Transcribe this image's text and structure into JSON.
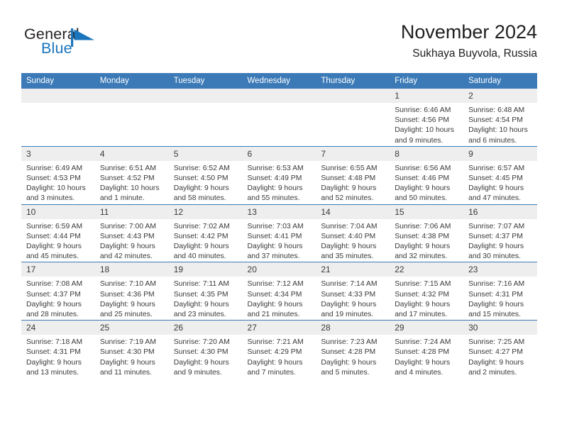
{
  "brand": {
    "name_part1": "General",
    "name_part2": "Blue",
    "logo_color": "#1b75bc"
  },
  "header": {
    "title": "November 2024",
    "location": "Sukhaya Buyvola, Russia",
    "accent_color": "#3b7ab7"
  },
  "weekday_headers": [
    "Sunday",
    "Monday",
    "Tuesday",
    "Wednesday",
    "Thursday",
    "Friday",
    "Saturday"
  ],
  "labels": {
    "sunrise_prefix": "Sunrise:",
    "sunset_prefix": "Sunset:",
    "daylight_prefix": "Daylight:"
  },
  "weeks": [
    [
      {
        "day": "",
        "sunrise": "",
        "sunset": "",
        "daylight_line1": "",
        "daylight_line2": ""
      },
      {
        "day": "",
        "sunrise": "",
        "sunset": "",
        "daylight_line1": "",
        "daylight_line2": ""
      },
      {
        "day": "",
        "sunrise": "",
        "sunset": "",
        "daylight_line1": "",
        "daylight_line2": ""
      },
      {
        "day": "",
        "sunrise": "",
        "sunset": "",
        "daylight_line1": "",
        "daylight_line2": ""
      },
      {
        "day": "",
        "sunrise": "",
        "sunset": "",
        "daylight_line1": "",
        "daylight_line2": ""
      },
      {
        "day": "1",
        "sunrise": "Sunrise: 6:46 AM",
        "sunset": "Sunset: 4:56 PM",
        "daylight_line1": "Daylight: 10 hours",
        "daylight_line2": "and 9 minutes."
      },
      {
        "day": "2",
        "sunrise": "Sunrise: 6:48 AM",
        "sunset": "Sunset: 4:54 PM",
        "daylight_line1": "Daylight: 10 hours",
        "daylight_line2": "and 6 minutes."
      }
    ],
    [
      {
        "day": "3",
        "sunrise": "Sunrise: 6:49 AM",
        "sunset": "Sunset: 4:53 PM",
        "daylight_line1": "Daylight: 10 hours",
        "daylight_line2": "and 3 minutes."
      },
      {
        "day": "4",
        "sunrise": "Sunrise: 6:51 AM",
        "sunset": "Sunset: 4:52 PM",
        "daylight_line1": "Daylight: 10 hours",
        "daylight_line2": "and 1 minute."
      },
      {
        "day": "5",
        "sunrise": "Sunrise: 6:52 AM",
        "sunset": "Sunset: 4:50 PM",
        "daylight_line1": "Daylight: 9 hours",
        "daylight_line2": "and 58 minutes."
      },
      {
        "day": "6",
        "sunrise": "Sunrise: 6:53 AM",
        "sunset": "Sunset: 4:49 PM",
        "daylight_line1": "Daylight: 9 hours",
        "daylight_line2": "and 55 minutes."
      },
      {
        "day": "7",
        "sunrise": "Sunrise: 6:55 AM",
        "sunset": "Sunset: 4:48 PM",
        "daylight_line1": "Daylight: 9 hours",
        "daylight_line2": "and 52 minutes."
      },
      {
        "day": "8",
        "sunrise": "Sunrise: 6:56 AM",
        "sunset": "Sunset: 4:46 PM",
        "daylight_line1": "Daylight: 9 hours",
        "daylight_line2": "and 50 minutes."
      },
      {
        "day": "9",
        "sunrise": "Sunrise: 6:57 AM",
        "sunset": "Sunset: 4:45 PM",
        "daylight_line1": "Daylight: 9 hours",
        "daylight_line2": "and 47 minutes."
      }
    ],
    [
      {
        "day": "10",
        "sunrise": "Sunrise: 6:59 AM",
        "sunset": "Sunset: 4:44 PM",
        "daylight_line1": "Daylight: 9 hours",
        "daylight_line2": "and 45 minutes."
      },
      {
        "day": "11",
        "sunrise": "Sunrise: 7:00 AM",
        "sunset": "Sunset: 4:43 PM",
        "daylight_line1": "Daylight: 9 hours",
        "daylight_line2": "and 42 minutes."
      },
      {
        "day": "12",
        "sunrise": "Sunrise: 7:02 AM",
        "sunset": "Sunset: 4:42 PM",
        "daylight_line1": "Daylight: 9 hours",
        "daylight_line2": "and 40 minutes."
      },
      {
        "day": "13",
        "sunrise": "Sunrise: 7:03 AM",
        "sunset": "Sunset: 4:41 PM",
        "daylight_line1": "Daylight: 9 hours",
        "daylight_line2": "and 37 minutes."
      },
      {
        "day": "14",
        "sunrise": "Sunrise: 7:04 AM",
        "sunset": "Sunset: 4:40 PM",
        "daylight_line1": "Daylight: 9 hours",
        "daylight_line2": "and 35 minutes."
      },
      {
        "day": "15",
        "sunrise": "Sunrise: 7:06 AM",
        "sunset": "Sunset: 4:38 PM",
        "daylight_line1": "Daylight: 9 hours",
        "daylight_line2": "and 32 minutes."
      },
      {
        "day": "16",
        "sunrise": "Sunrise: 7:07 AM",
        "sunset": "Sunset: 4:37 PM",
        "daylight_line1": "Daylight: 9 hours",
        "daylight_line2": "and 30 minutes."
      }
    ],
    [
      {
        "day": "17",
        "sunrise": "Sunrise: 7:08 AM",
        "sunset": "Sunset: 4:37 PM",
        "daylight_line1": "Daylight: 9 hours",
        "daylight_line2": "and 28 minutes."
      },
      {
        "day": "18",
        "sunrise": "Sunrise: 7:10 AM",
        "sunset": "Sunset: 4:36 PM",
        "daylight_line1": "Daylight: 9 hours",
        "daylight_line2": "and 25 minutes."
      },
      {
        "day": "19",
        "sunrise": "Sunrise: 7:11 AM",
        "sunset": "Sunset: 4:35 PM",
        "daylight_line1": "Daylight: 9 hours",
        "daylight_line2": "and 23 minutes."
      },
      {
        "day": "20",
        "sunrise": "Sunrise: 7:12 AM",
        "sunset": "Sunset: 4:34 PM",
        "daylight_line1": "Daylight: 9 hours",
        "daylight_line2": "and 21 minutes."
      },
      {
        "day": "21",
        "sunrise": "Sunrise: 7:14 AM",
        "sunset": "Sunset: 4:33 PM",
        "daylight_line1": "Daylight: 9 hours",
        "daylight_line2": "and 19 minutes."
      },
      {
        "day": "22",
        "sunrise": "Sunrise: 7:15 AM",
        "sunset": "Sunset: 4:32 PM",
        "daylight_line1": "Daylight: 9 hours",
        "daylight_line2": "and 17 minutes."
      },
      {
        "day": "23",
        "sunrise": "Sunrise: 7:16 AM",
        "sunset": "Sunset: 4:31 PM",
        "daylight_line1": "Daylight: 9 hours",
        "daylight_line2": "and 15 minutes."
      }
    ],
    [
      {
        "day": "24",
        "sunrise": "Sunrise: 7:18 AM",
        "sunset": "Sunset: 4:31 PM",
        "daylight_line1": "Daylight: 9 hours",
        "daylight_line2": "and 13 minutes."
      },
      {
        "day": "25",
        "sunrise": "Sunrise: 7:19 AM",
        "sunset": "Sunset: 4:30 PM",
        "daylight_line1": "Daylight: 9 hours",
        "daylight_line2": "and 11 minutes."
      },
      {
        "day": "26",
        "sunrise": "Sunrise: 7:20 AM",
        "sunset": "Sunset: 4:30 PM",
        "daylight_line1": "Daylight: 9 hours",
        "daylight_line2": "and 9 minutes."
      },
      {
        "day": "27",
        "sunrise": "Sunrise: 7:21 AM",
        "sunset": "Sunset: 4:29 PM",
        "daylight_line1": "Daylight: 9 hours",
        "daylight_line2": "and 7 minutes."
      },
      {
        "day": "28",
        "sunrise": "Sunrise: 7:23 AM",
        "sunset": "Sunset: 4:28 PM",
        "daylight_line1": "Daylight: 9 hours",
        "daylight_line2": "and 5 minutes."
      },
      {
        "day": "29",
        "sunrise": "Sunrise: 7:24 AM",
        "sunset": "Sunset: 4:28 PM",
        "daylight_line1": "Daylight: 9 hours",
        "daylight_line2": "and 4 minutes."
      },
      {
        "day": "30",
        "sunrise": "Sunrise: 7:25 AM",
        "sunset": "Sunset: 4:27 PM",
        "daylight_line1": "Daylight: 9 hours",
        "daylight_line2": "and 2 minutes."
      }
    ]
  ]
}
